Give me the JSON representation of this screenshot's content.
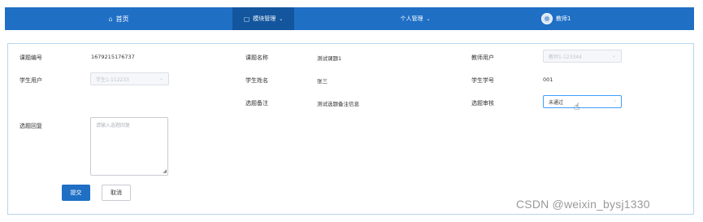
{
  "nav": {
    "home_label": "首页",
    "module_label": "模块管理",
    "personal_label": "个人管理",
    "user_label": "教师1",
    "home_icon": "home-icon",
    "module_icon": "module-icon",
    "caret_icon": "chevron-down-icon",
    "caret_glyph": "⌄",
    "bar_color": "#1f6fc5",
    "active_color": "#13569e"
  },
  "form": {
    "topic_no_label": "课题编号",
    "topic_no_value": "1679215176737",
    "topic_name_label": "课题名称",
    "topic_name_value": "测试课题1",
    "teacher_user_label": "教师用户",
    "teacher_user_value": "教师1-123344",
    "student_user_label": "学生用户",
    "student_user_value": "学生1-112233",
    "student_name_label": "学生姓名",
    "student_name_value": "张三",
    "student_no_label": "学生学号",
    "student_no_value": "001",
    "remark_label": "选题备注",
    "remark_value": "测试选题备注信息",
    "review_label": "选题审核",
    "review_value": "未通过",
    "reply_label": "选题回复",
    "reply_placeholder": "请输入选题回复",
    "submit_label": "提交",
    "cancel_label": "取消"
  },
  "watermark": "CSDN @weixin_bysj1330"
}
